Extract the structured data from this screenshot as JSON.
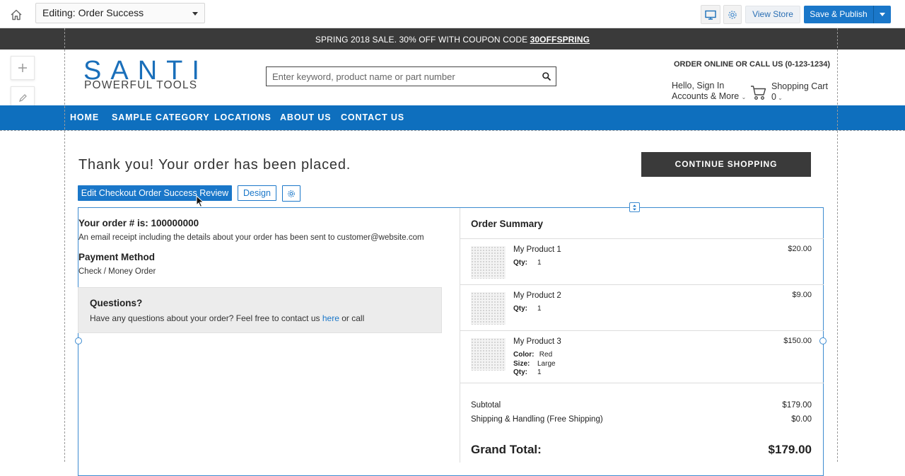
{
  "editor": {
    "page_select": "Editing: Order Success",
    "view_store": "View Store",
    "publish": "Save & Publish"
  },
  "promo": {
    "text": "SPRING 2018 SALE. 30% OFF WITH COUPON CODE ",
    "code": "30OFFSPRING"
  },
  "header": {
    "logo_top": "SANTI",
    "logo_bottom": "POWERFUL TOOLS",
    "search_placeholder": "Enter keyword, product name or part number",
    "call": "ORDER ONLINE OR CALL US (0-123-1234)",
    "account_line1": "Hello, Sign In",
    "account_line2": "Accounts & More",
    "cart_label": "Shopping Cart",
    "cart_count": "0"
  },
  "nav": [
    "HOME",
    "SAMPLE CATEGORY",
    "LOCATIONS",
    "ABOUT US",
    "CONTACT US"
  ],
  "page": {
    "thanks": "Thank you! Your order has been placed.",
    "continue": "CONTINUE SHOPPING",
    "edit_button": "Edit Checkout Order Success Review",
    "design_button": "Design"
  },
  "order": {
    "number_line": "Your order # is: 100000000",
    "email_note": "An email receipt including the details about your order has been sent to customer@website.com",
    "payment_head": "Payment Method",
    "payment_value": "Check / Money Order",
    "questions_head": "Questions?",
    "questions_text_before": "Have any questions about your order? Feel free to contact us ",
    "questions_link": "here",
    "questions_text_after": " or call"
  },
  "summary": {
    "title": "Order Summary",
    "items": [
      {
        "name": "My Product 1",
        "price": "$20.00",
        "qty_label": "Qty:",
        "qty": "1"
      },
      {
        "name": "My Product 2",
        "price": "$9.00",
        "qty_label": "Qty:",
        "qty": "1"
      },
      {
        "name": "My Product 3",
        "price": "$150.00",
        "color_label": "Color:",
        "color": "Red",
        "size_label": "Size:",
        "size": "Large",
        "qty_label": "Qty:",
        "qty": "1"
      }
    ],
    "subtotal_label": "Subtotal",
    "subtotal": "$179.00",
    "shipping_label": "Shipping & Handling (Free Shipping)",
    "shipping": "$0.00",
    "grand_label": "Grand Total:",
    "grand": "$179.00"
  },
  "colors": {
    "brand_blue": "#0e6fbe",
    "promo_bg": "#3a3a3a",
    "button_blue": "#1a77c9"
  }
}
